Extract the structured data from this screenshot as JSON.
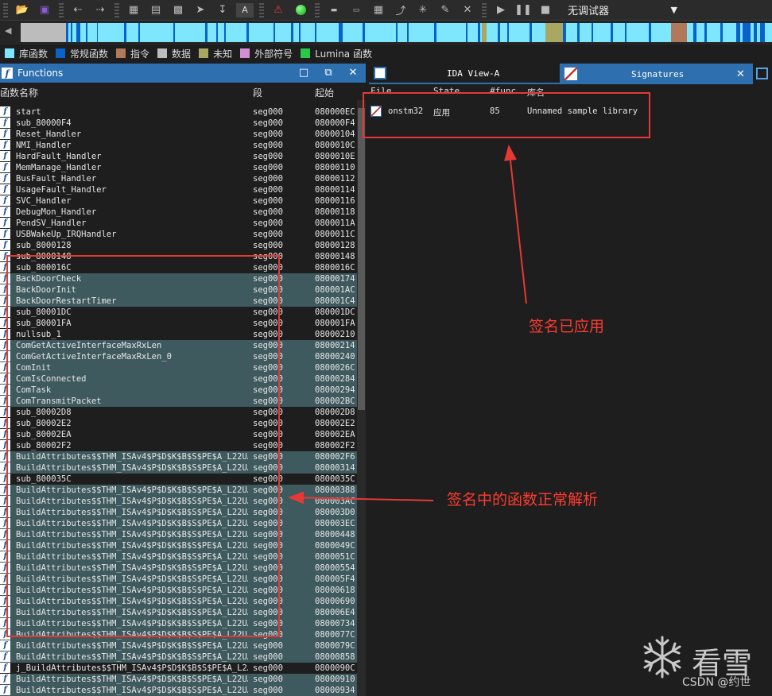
{
  "toolbar": {
    "icons": [
      "open-file-icon",
      "save-icon",
      "back-icon",
      "forward-icon",
      "code-icon",
      "text-icon",
      "data-icon",
      "jump-icon",
      "down-icon",
      "string-icon",
      "warning-icon",
      "run-green-icon",
      "debug-icon",
      "data-type-icon",
      "string-type-icon",
      "align-icon",
      "cross-ref-icon",
      "edit-icon",
      "close-icon",
      "play-icon",
      "pause-icon",
      "stop-icon"
    ],
    "debugger_label": "无调试器",
    "debugger_arrow": "▼"
  },
  "legend": [
    {
      "label": "库函数",
      "color": "#7fe6ff"
    },
    {
      "label": "常规函数",
      "color": "#0a61c7"
    },
    {
      "label": "指令",
      "color": "#b07a5a"
    },
    {
      "label": "数据",
      "color": "#bcbcbc"
    },
    {
      "label": "未知",
      "color": "#a9a862"
    },
    {
      "label": "外部符号",
      "color": "#d48fd4"
    },
    {
      "label": "Lumina 函数",
      "color": "#29c94a"
    }
  ],
  "functions_pane": {
    "title": "Functions",
    "columns": {
      "name": "函数名称",
      "segment": "段",
      "start": "起始"
    },
    "rows": [
      {
        "name": "start",
        "seg": "seg000",
        "addr": "080000EC",
        "lib": false
      },
      {
        "name": "sub_80000F4",
        "seg": "seg000",
        "addr": "080000F4",
        "lib": false
      },
      {
        "name": "Reset_Handler",
        "seg": "seg000",
        "addr": "08000104",
        "lib": false
      },
      {
        "name": "NMI_Handler",
        "seg": "seg000",
        "addr": "0800010C",
        "lib": false
      },
      {
        "name": "HardFault_Handler",
        "seg": "seg000",
        "addr": "0800010E",
        "lib": false
      },
      {
        "name": "MemManage_Handler",
        "seg": "seg000",
        "addr": "08000110",
        "lib": false
      },
      {
        "name": "BusFault_Handler",
        "seg": "seg000",
        "addr": "08000112",
        "lib": false
      },
      {
        "name": "UsageFault_Handler",
        "seg": "seg000",
        "addr": "08000114",
        "lib": false
      },
      {
        "name": "SVC_Handler",
        "seg": "seg000",
        "addr": "08000116",
        "lib": false
      },
      {
        "name": "DebugMon_Handler",
        "seg": "seg000",
        "addr": "08000118",
        "lib": false
      },
      {
        "name": "PendSV_Handler",
        "seg": "seg000",
        "addr": "0800011A",
        "lib": false
      },
      {
        "name": "USBWakeUp_IRQHandler",
        "seg": "seg000",
        "addr": "0800011C",
        "lib": false
      },
      {
        "name": "sub_8000128",
        "seg": "seg000",
        "addr": "08000128",
        "lib": false
      },
      {
        "name": "sub_8000148",
        "seg": "seg000",
        "addr": "08000148",
        "lib": false
      },
      {
        "name": "sub_800016C",
        "seg": "seg000",
        "addr": "0800016C",
        "lib": false
      },
      {
        "name": "BackDoorCheck",
        "seg": "seg000",
        "addr": "08000174",
        "lib": true
      },
      {
        "name": "BackDoorInit",
        "seg": "seg000",
        "addr": "080001AC",
        "lib": true
      },
      {
        "name": "BackDoorRestartTimer",
        "seg": "seg000",
        "addr": "080001C4",
        "lib": true
      },
      {
        "name": "sub_80001DC",
        "seg": "seg000",
        "addr": "080001DC",
        "lib": false
      },
      {
        "name": "sub_80001FA",
        "seg": "seg000",
        "addr": "080001FA",
        "lib": false
      },
      {
        "name": "nullsub_1",
        "seg": "seg000",
        "addr": "08000210",
        "lib": false
      },
      {
        "name": "ComGetActiveInterfaceMaxRxLen",
        "seg": "seg000",
        "addr": "08000214",
        "lib": true
      },
      {
        "name": "ComGetActiveInterfaceMaxRxLen_0",
        "seg": "seg000",
        "addr": "08000240",
        "lib": true
      },
      {
        "name": "ComInit",
        "seg": "seg000",
        "addr": "0800026C",
        "lib": true
      },
      {
        "name": "ComIsConnected",
        "seg": "seg000",
        "addr": "08000284",
        "lib": true
      },
      {
        "name": "ComTask",
        "seg": "seg000",
        "addr": "08000294",
        "lib": true
      },
      {
        "name": "ComTransmitPacket",
        "seg": "seg000",
        "addr": "080002BC",
        "lib": true
      },
      {
        "name": "sub_80002D8",
        "seg": "seg000",
        "addr": "080002D8",
        "lib": false
      },
      {
        "name": "sub_80002E2",
        "seg": "seg000",
        "addr": "080002E2",
        "lib": false
      },
      {
        "name": "sub_80002EA",
        "seg": "seg000",
        "addr": "080002EA",
        "lib": false
      },
      {
        "name": "sub_80002F2",
        "seg": "seg000",
        "addr": "080002F2",
        "lib": false
      },
      {
        "name": "BuildAttributes$$THM_ISAv4$P$D$K$B$S$PE$A_L22U…",
        "seg": "seg000",
        "addr": "080002F6",
        "lib": true
      },
      {
        "name": "BuildAttributes$$THM_ISAv4$P$D$K$B$S$PE$A_L22U…",
        "seg": "seg000",
        "addr": "08000314",
        "lib": true
      },
      {
        "name": "sub_800035C",
        "seg": "seg000",
        "addr": "0800035C",
        "lib": false
      },
      {
        "name": "BuildAttributes$$THM_ISAv4$P$D$K$B$S$PE$A_L22U…",
        "seg": "seg000",
        "addr": "08000388",
        "lib": true
      },
      {
        "name": "BuildAttributes$$THM_ISAv4$P$D$K$B$S$PE$A_L22U…",
        "seg": "seg000",
        "addr": "080003AC",
        "lib": true
      },
      {
        "name": "BuildAttributes$$THM_ISAv4$P$D$K$B$S$PE$A_L22U…",
        "seg": "seg000",
        "addr": "080003D0",
        "lib": true
      },
      {
        "name": "BuildAttributes$$THM_ISAv4$P$D$K$B$S$PE$A_L22U…",
        "seg": "seg000",
        "addr": "080003EC",
        "lib": true
      },
      {
        "name": "BuildAttributes$$THM_ISAv4$P$D$K$B$S$PE$A_L22U…",
        "seg": "seg000",
        "addr": "08000448",
        "lib": true
      },
      {
        "name": "BuildAttributes$$THM_ISAv4$P$D$K$B$S$PE$A_L22U…",
        "seg": "seg000",
        "addr": "0800049C",
        "lib": true
      },
      {
        "name": "BuildAttributes$$THM_ISAv4$P$D$K$B$S$PE$A_L22U…",
        "seg": "seg000",
        "addr": "0800051C",
        "lib": true
      },
      {
        "name": "BuildAttributes$$THM_ISAv4$P$D$K$B$S$PE$A_L22U…",
        "seg": "seg000",
        "addr": "08000554",
        "lib": true
      },
      {
        "name": "BuildAttributes$$THM_ISAv4$P$D$K$B$S$PE$A_L22U…",
        "seg": "seg000",
        "addr": "080005F4",
        "lib": true
      },
      {
        "name": "BuildAttributes$$THM_ISAv4$P$D$K$B$S$PE$A_L22U…",
        "seg": "seg000",
        "addr": "08000618",
        "lib": true
      },
      {
        "name": "BuildAttributes$$THM_ISAv4$P$D$K$B$S$PE$A_L22U…",
        "seg": "seg000",
        "addr": "08000690",
        "lib": true
      },
      {
        "name": "BuildAttributes$$THM_ISAv4$P$D$K$B$S$PE$A_L22U…",
        "seg": "seg000",
        "addr": "080006E4",
        "lib": true
      },
      {
        "name": "BuildAttributes$$THM_ISAv4$P$D$K$B$S$PE$A_L22U…",
        "seg": "seg000",
        "addr": "08000734",
        "lib": true
      },
      {
        "name": "BuildAttributes$$THM_ISAv4$P$D$K$B$S$PE$A_L22U…",
        "seg": "seg000",
        "addr": "0800077C",
        "lib": true
      },
      {
        "name": "BuildAttributes$$THM_ISAv4$P$D$K$B$S$PE$A_L22U…",
        "seg": "seg000",
        "addr": "0800079C",
        "lib": true
      },
      {
        "name": "BuildAttributes$$THM_ISAv4$P$D$K$B$S$PE$A_L22U…",
        "seg": "seg000",
        "addr": "08000858",
        "lib": true
      },
      {
        "name": "j_BuildAttributes$$THM_ISAv4$P$D$K$B$S$PE$A_L2…",
        "seg": "seg000",
        "addr": "0800090C",
        "lib": false
      },
      {
        "name": "BuildAttributes$$THM_ISAv4$P$D$K$B$S$PE$A_L22U…",
        "seg": "seg000",
        "addr": "08000910",
        "lib": true
      },
      {
        "name": "BuildAttributes$$THM_ISAv4$P$D$K$B$S$PE$A_L22U…",
        "seg": "seg000",
        "addr": "08000934",
        "lib": true
      }
    ]
  },
  "tabs": {
    "ida_view": "IDA View-A",
    "signatures": "Signatures"
  },
  "signatures": {
    "columns": {
      "file": "File",
      "state": "State",
      "funcs": "#func",
      "library": "库名"
    },
    "rows": [
      {
        "file": "onstm32",
        "state": "应用",
        "funcs": "85",
        "library": "Unnamed sample library"
      }
    ]
  },
  "annotations": {
    "applied": "签名已应用",
    "parsed": "签名中的函数正常解析"
  },
  "watermark": {
    "brand": "看雪",
    "csdn": "CSDN @约世"
  }
}
